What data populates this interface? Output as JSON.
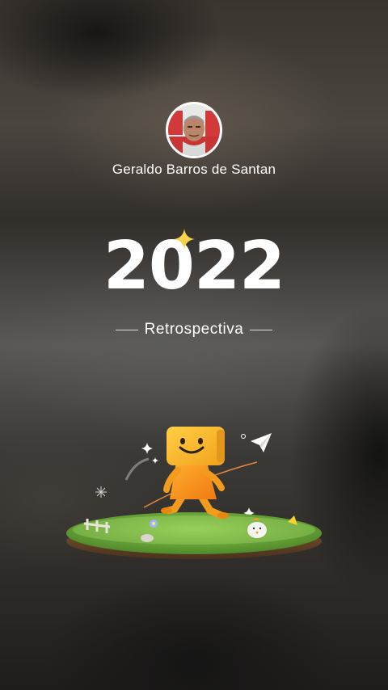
{
  "profile": {
    "name": "Geraldo Barros de Santan"
  },
  "header": {
    "year": "2022",
    "subtitle": "Retrospectiva"
  },
  "icons": {
    "sparkle": "sparkle-icon",
    "paper_plane": "paper-plane-icon",
    "mascot": "yellow-box-mascot"
  },
  "colors": {
    "accent_yellow": "#f5b82e",
    "grass_green": "#6fae3c",
    "text_white": "#ffffff"
  }
}
